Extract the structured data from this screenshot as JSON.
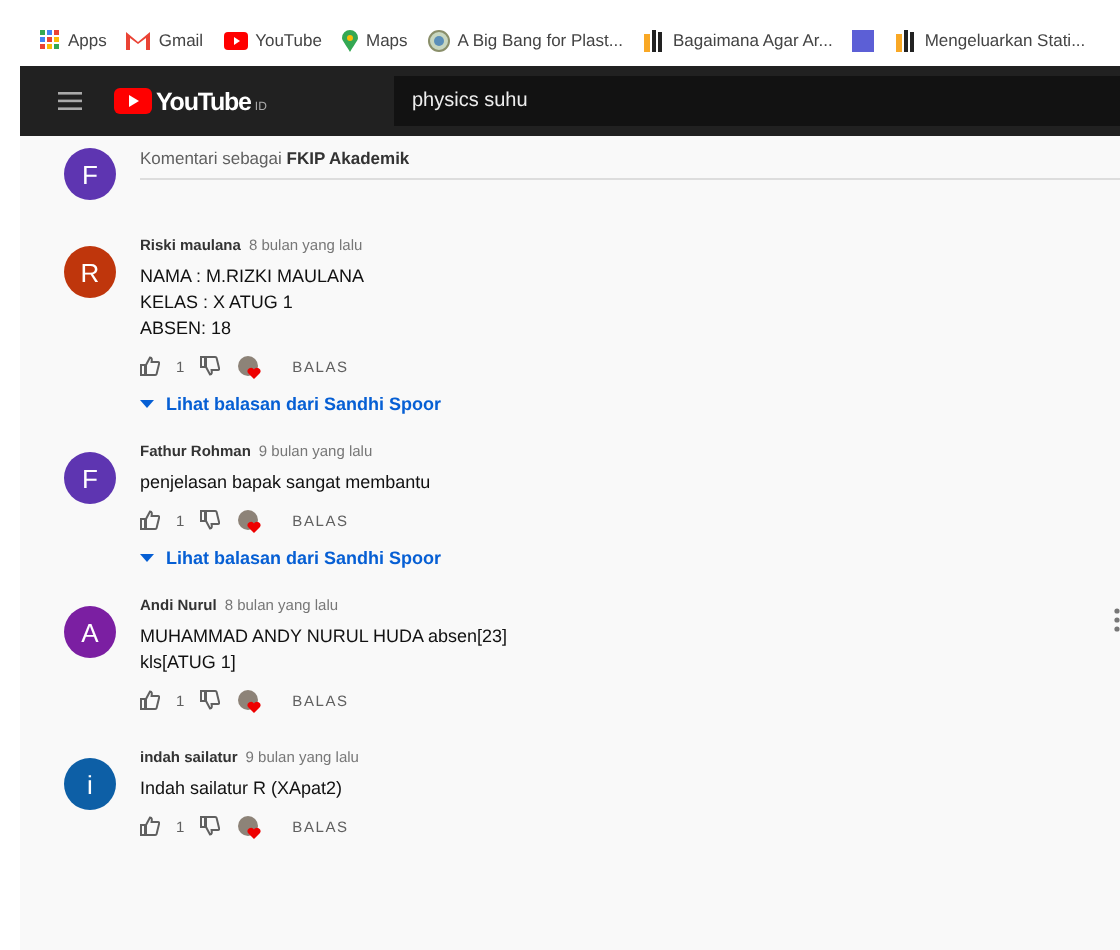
{
  "bookmarks": [
    {
      "kind": "apps",
      "label": "Apps"
    },
    {
      "kind": "gmail",
      "label": "Gmail"
    },
    {
      "kind": "youtube",
      "label": "YouTube"
    },
    {
      "kind": "maps",
      "label": "Maps"
    },
    {
      "kind": "globe",
      "label": "A Big Bang for Plast..."
    },
    {
      "kind": "site",
      "label": "Bagaimana Agar Ar..."
    },
    {
      "kind": "square"
    },
    {
      "kind": "site",
      "label": "Mengeluarkan Stati..."
    }
  ],
  "header": {
    "logo": "YouTube",
    "region": "ID",
    "search": "physics suhu"
  },
  "comment_box": {
    "avatar": "F",
    "color": "#5e35b1",
    "text": "Komentari sebagai **FKIP Akademik**"
  },
  "comments": [
    {
      "avatar": "R",
      "color": "#bf360c",
      "author": "Riski maulana",
      "time": "8 bulan yang lalu",
      "lines": [
        "NAMA : M.RIZKI MAULANA",
        "KELAS : X ATUG 1",
        "ABSEN: 18"
      ],
      "likes": "1",
      "hearted": true,
      "reply": "BALAS",
      "replies_link": "Lihat balasan dari Sandhi Spoor",
      "menu_shown": false
    },
    {
      "avatar": "F",
      "color": "#5e35b1",
      "author": "Fathur Rohman",
      "time": "9 bulan yang lalu",
      "lines": [
        "penjelasan bapak sangat membantu"
      ],
      "likes": "1",
      "hearted": true,
      "reply": "BALAS",
      "replies_link": "Lihat balasan dari Sandhi Spoor",
      "menu_shown": false
    },
    {
      "avatar": "A",
      "color": "#7b1fa2",
      "author": "Andi Nurul",
      "time": "8 bulan yang lalu",
      "lines": [
        "MUHAMMAD ANDY NURUL HUDA absen[23]",
        "kls[ATUG 1]"
      ],
      "likes": "1",
      "hearted": true,
      "reply": "BALAS",
      "menu_shown": true
    },
    {
      "avatar": "i",
      "color": "#0d5fa6",
      "author": "indah sailatur",
      "time": "9 bulan yang lalu",
      "lines": [
        "Indah sailatur R (XApat2)"
      ],
      "likes": "1",
      "hearted": true,
      "reply": "BALAS",
      "menu_shown": false
    }
  ]
}
